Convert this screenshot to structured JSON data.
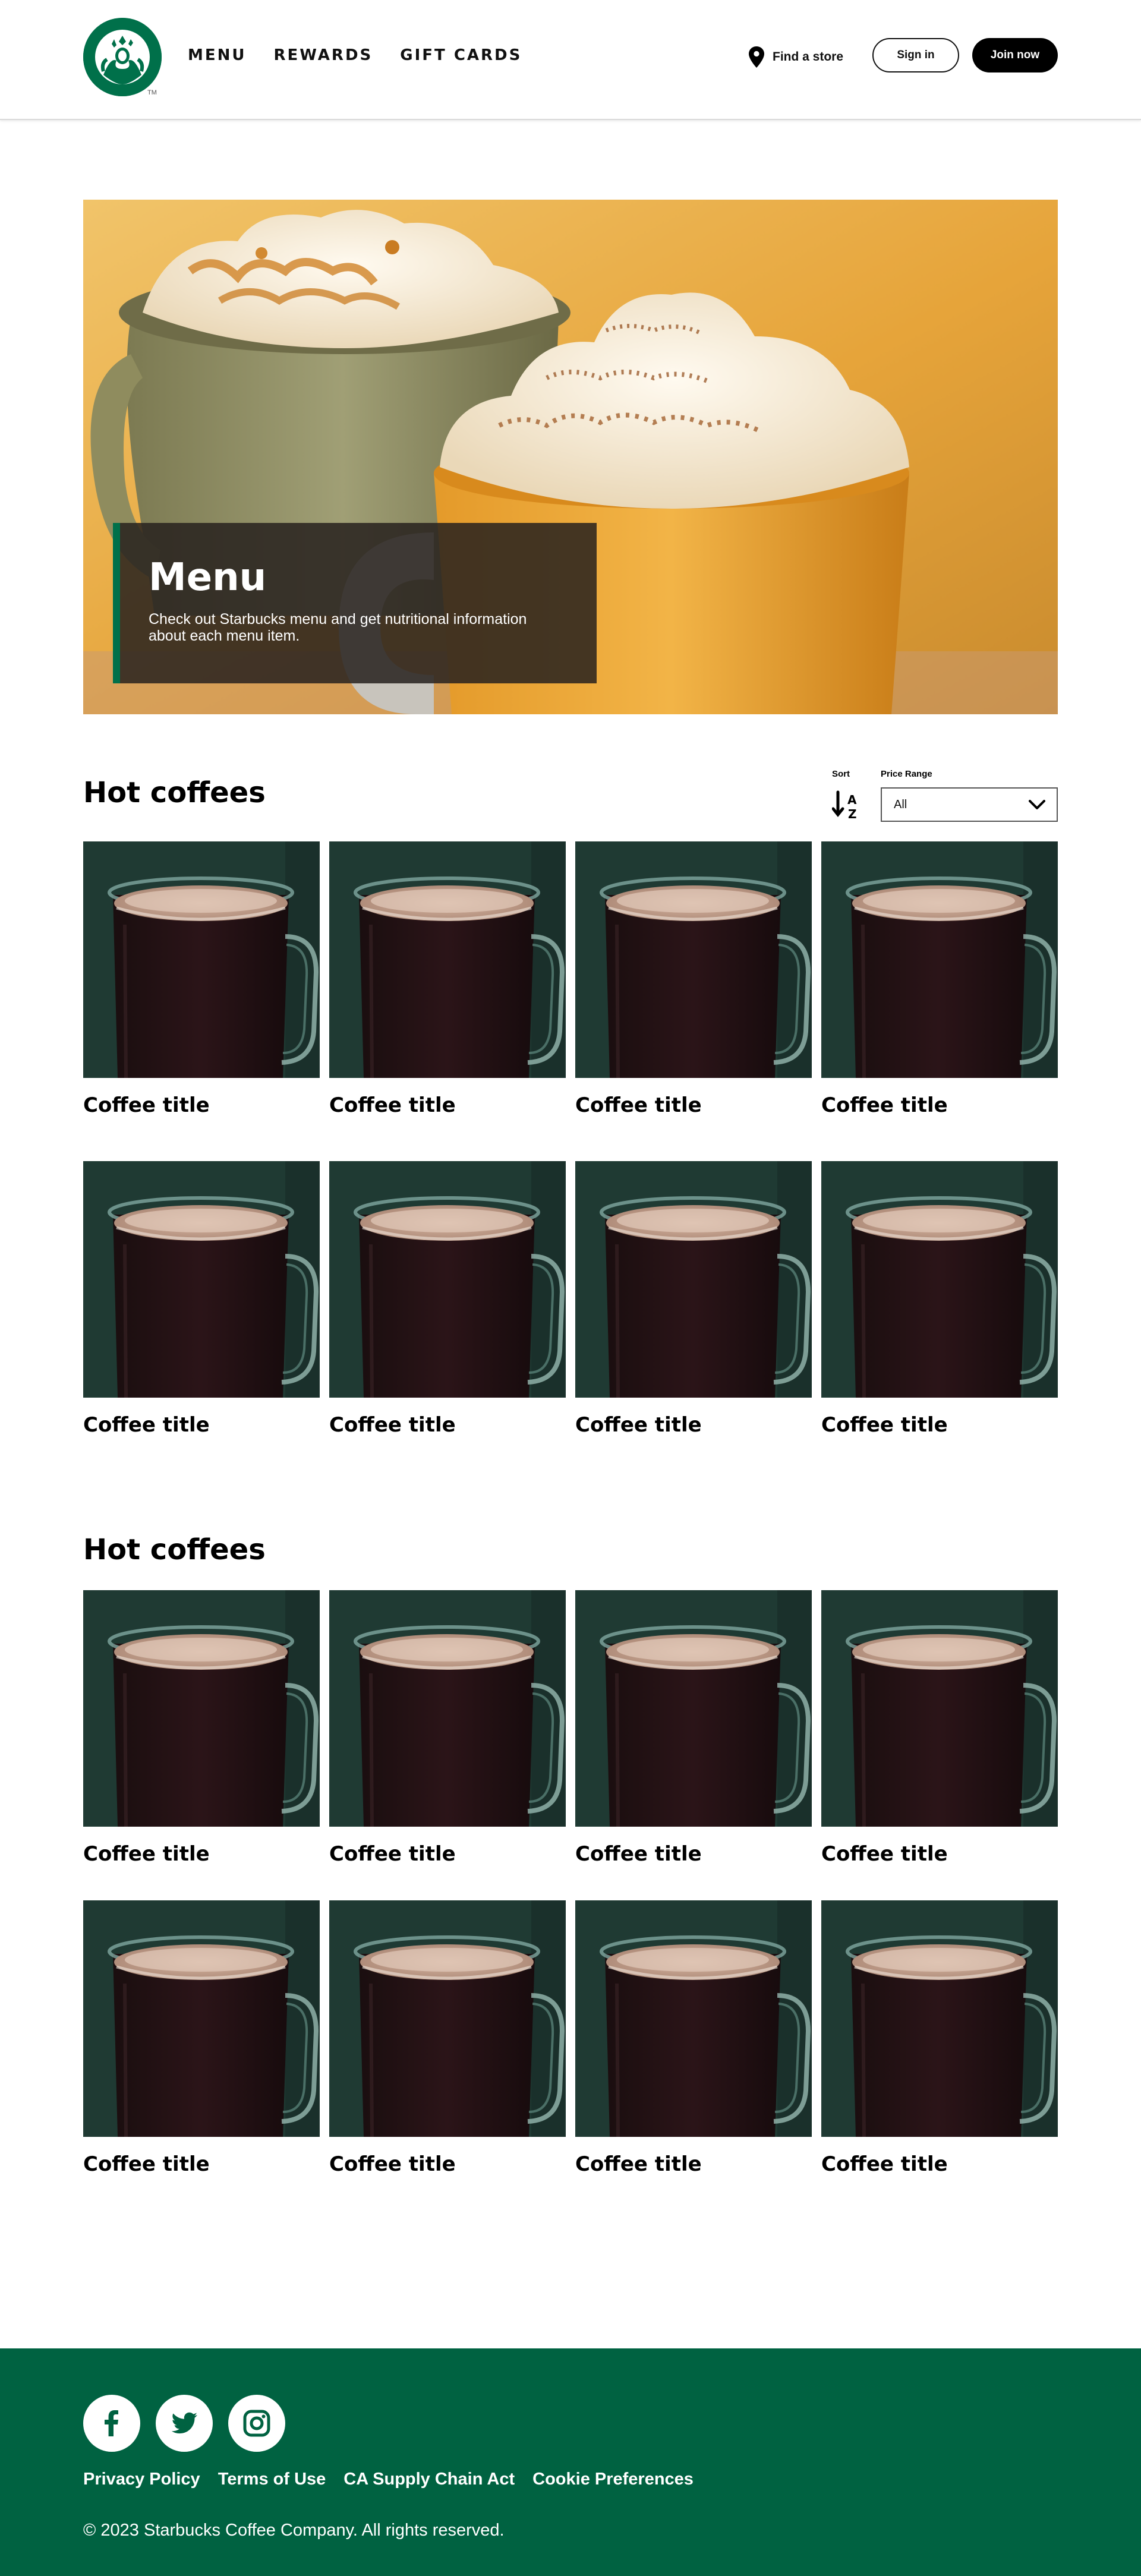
{
  "header": {
    "nav": [
      "MENU",
      "REWARDS",
      "GIFT CARDS"
    ],
    "find_store": "Find a store",
    "sign_in": "Sign in",
    "join_now": "Join now",
    "logo_tm": "TM"
  },
  "hero": {
    "title": "Menu",
    "subtitle": "Check out Starbucks menu and get nutritional information about each menu item."
  },
  "section_one": {
    "title": "Hot coffees",
    "sort_label": "Sort",
    "price_label": "Price Range",
    "price_value": "All",
    "items": [
      "Coffee title",
      "Coffee title",
      "Coffee title",
      "Coffee title",
      "Coffee title",
      "Coffee title",
      "Coffee title",
      "Coffee title"
    ]
  },
  "section_two": {
    "title": "Hot coffees",
    "items": [
      "Coffee title",
      "Coffee title",
      "Coffee title",
      "Coffee title",
      "Coffee title",
      "Coffee title",
      "Coffee title",
      "Coffee title"
    ]
  },
  "footer": {
    "socials": [
      "facebook-icon",
      "twitter-icon",
      "instagram-icon"
    ],
    "links": [
      "Privacy Policy",
      "Terms of Use",
      "CA Supply Chain Act",
      "Cookie Preferences"
    ],
    "copyright": "© 2023 Starbucks Coffee Company. All rights reserved."
  },
  "colors": {
    "brand_green": "#00704a",
    "footer_green": "#006241",
    "card_bg": "#1f3a33",
    "black": "#000000"
  }
}
